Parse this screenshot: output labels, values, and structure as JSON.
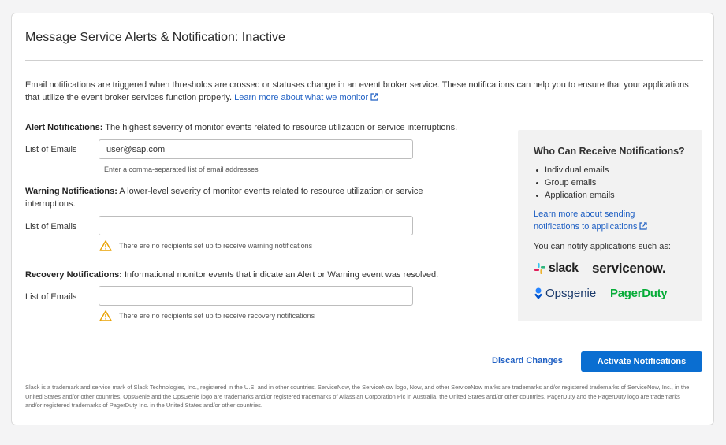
{
  "page": {
    "title": "Message Service Alerts & Notification: Inactive",
    "intro_text": "Email notifications are triggered when thresholds are crossed or statuses change in an event broker service. These notifications can help you to ensure that your applications that utilize the event broker services function properly.",
    "intro_link": "Learn more about what we monitor"
  },
  "alert": {
    "heading": "Alert Notifications:",
    "description": "The highest severity of monitor events related to resource utilization or service interruptions.",
    "label": "List of Emails",
    "value": "user@sap.com",
    "hint": "Enter a comma-separated list of email addresses"
  },
  "warning": {
    "heading": "Warning Notifications:",
    "description": "A lower-level severity of monitor events related to resource utilization or service interruptions.",
    "label": "List of Emails",
    "value": "",
    "message": "There are no recipients set up to receive warning notifications"
  },
  "recovery": {
    "heading": "Recovery Notifications:",
    "description": "Informational monitor events that indicate an Alert or Warning event was resolved.",
    "label": "List of Emails",
    "value": "",
    "message": "There are no recipients set up to receive recovery notifications"
  },
  "sidebar": {
    "title": "Who Can Receive Notifications?",
    "items": [
      "Individual emails",
      "Group emails",
      "Application emails"
    ],
    "link": "Learn more about sending notifications to applications",
    "notify_text": "You can notify applications such as:",
    "logos": {
      "slack": "slack",
      "servicenow": "servicenow.",
      "opsgenie": "Opsgenie",
      "pagerduty": "PagerDuty"
    }
  },
  "actions": {
    "discard": "Discard Changes",
    "activate": "Activate Notifications"
  },
  "footer": {
    "text": "Slack is a trademark and service mark of Slack Technologies, Inc., registered in the U.S. and in other countries. ServiceNow, the ServiceNow logo, Now, and other ServiceNow marks are trademarks and/or registered trademarks of ServiceNow, Inc., in the United States and/or other countries. OpsGenie and the OpsGenie logo are trademarks and/or registered trademarks of Atlassian Corporation Plc in Australia, the United States and/or other countries. PagerDuty and the PagerDuty logo are trademarks and/or registered trademarks of PagerDuty Inc. in the United States and/or other countries."
  },
  "colors": {
    "accent": "#0a6ed1",
    "link": "#1e5fc3",
    "warning": "#e9a100",
    "pagerduty": "#06ac38"
  }
}
